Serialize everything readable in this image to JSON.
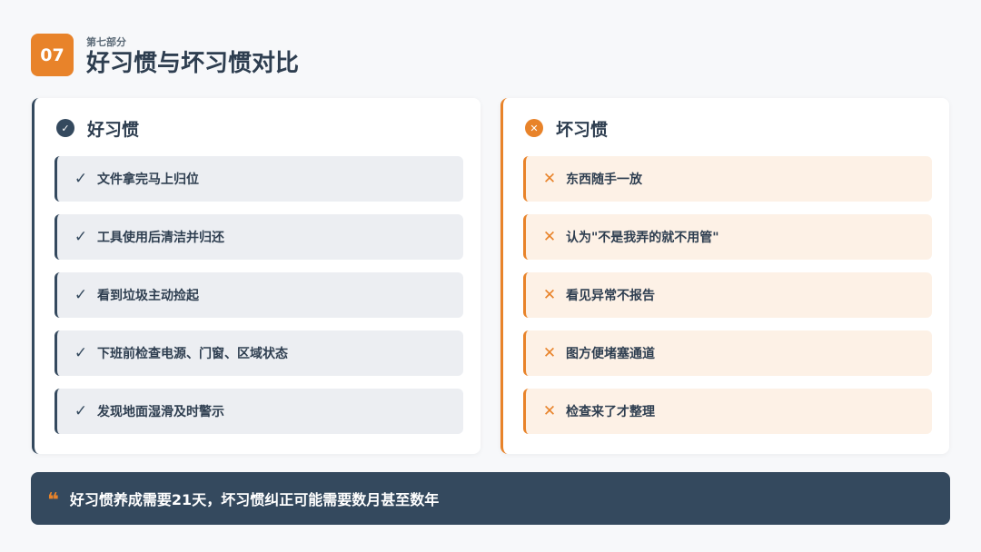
{
  "header": {
    "badge": "07",
    "subtitle": "第七部分",
    "title": "好习惯与坏习惯对比"
  },
  "good": {
    "title": "好习惯",
    "icon": "check-circle-icon",
    "items": [
      {
        "text": "文件拿完马上归位"
      },
      {
        "text": "工具使用后清洁并归还"
      },
      {
        "text": "看到垃圾主动捡起"
      },
      {
        "text": "下班前检查电源、门窗、区域状态"
      },
      {
        "text": "发现地面湿滑及时警示"
      }
    ]
  },
  "bad": {
    "title": "坏习惯",
    "icon": "x-circle-icon",
    "items": [
      {
        "text": "东西随手一放"
      },
      {
        "text": "认为\"不是我弄的就不用管\""
      },
      {
        "text": "看见异常不报告"
      },
      {
        "text": "图方便堵塞通道"
      },
      {
        "text": "检查来了才整理"
      }
    ]
  },
  "quote": {
    "icon": "quote-icon",
    "text": "好习惯养成需要21天，坏习惯纠正可能需要数月甚至数年"
  },
  "colors": {
    "accent": "#e8832a",
    "dark": "#34495e",
    "background": "#f7f8fa"
  }
}
